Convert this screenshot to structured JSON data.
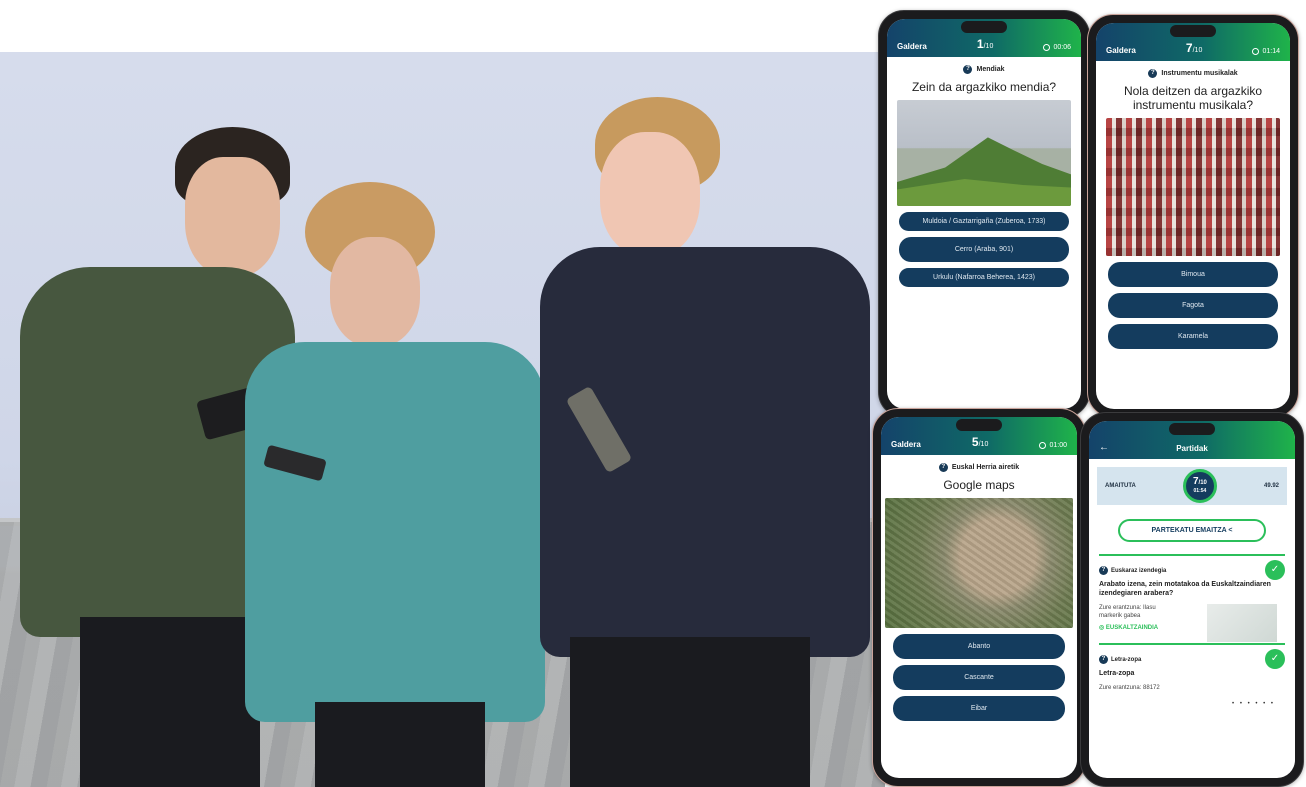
{
  "screens": {
    "s1": {
      "title": "Galdera",
      "counter_current": "1",
      "counter_total": "/10",
      "timer": "00:06",
      "category": "Mendiak",
      "question": "Zein da argazkiko mendia?",
      "image": "mountain-photo",
      "answers": [
        "Muldoia / Gaztarrigaña (Zuberoa, 1733)",
        "Cerro (Araba, 901)",
        "Urkulu (Nafarroa Beherea, 1423)"
      ]
    },
    "s2": {
      "title": "Galdera",
      "counter_current": "7",
      "counter_total": "/10",
      "timer": "01:14",
      "category": "Instrumentu musikalak",
      "question": "Nola deitzen da argazkiko instrumentu musikala?",
      "image": "marching-band-photo",
      "answers": [
        "Bimoua",
        "Fagota",
        "Karamela"
      ]
    },
    "s3": {
      "title": "Galdera",
      "counter_current": "5",
      "counter_total": "/10",
      "timer": "01:00",
      "category": "Euskal Herria airetik",
      "question": "Google maps",
      "image": "satellite-map",
      "answers": [
        "Abanto",
        "Cascante",
        "Eibar"
      ]
    },
    "s4": {
      "title": "Partidak",
      "status_label": "AMAITUTA",
      "score": "7",
      "score_total": "/10",
      "score_time": "01:54",
      "right_value": "49.92",
      "share_label": "PARTEKATU EMAITZA",
      "entries": [
        {
          "category": "Euskaraz izendegia",
          "question": "Arabato izena, zein motatakoa da Euskaltzaindiaren izendegiaren arabera?",
          "sub": "Zure erantzuna: Ilasu markerik gabea",
          "tag": "EUSKALTZAINDIA"
        },
        {
          "category": "Letra-zopa",
          "question": "Letra-zopa",
          "sub": "Zure erantzuna: 88172",
          "tag": ""
        }
      ]
    }
  },
  "colors": {
    "navy": "#143c5e",
    "green": "#2bbf5a",
    "wall": "#d6dcec"
  }
}
